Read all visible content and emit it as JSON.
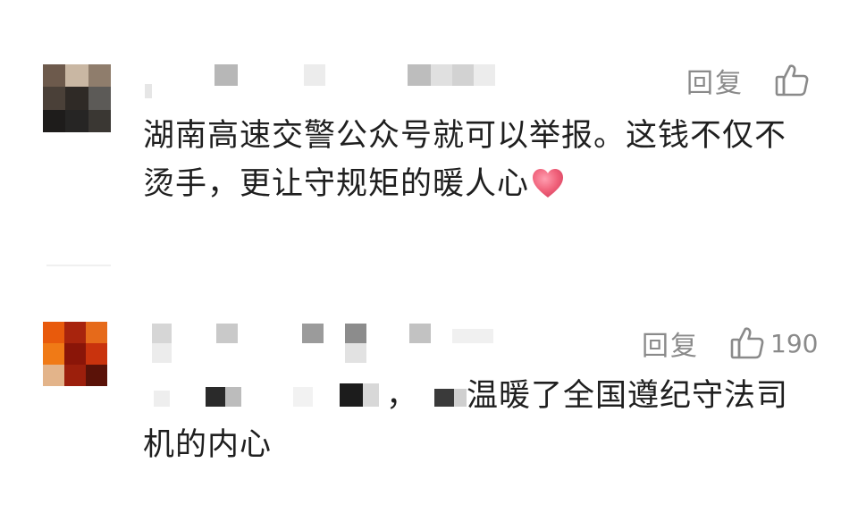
{
  "comments": [
    {
      "reply_label": "回复",
      "like_count": "",
      "text": "湖南高速交警公众号就可以举报。这钱不仅不烫手，更让守规矩的暖人心",
      "emoji": "heart-emoji"
    },
    {
      "reply_label": "回复",
      "like_count": "190",
      "text_visible": "，",
      "text_tail": "温暖了全国遵纪守法司",
      "text_line2": "机的内心"
    }
  ],
  "colors": {
    "secondary_text": "#8a8a8a",
    "body_text": "#1f1f1f",
    "heart": "#f0617a"
  }
}
